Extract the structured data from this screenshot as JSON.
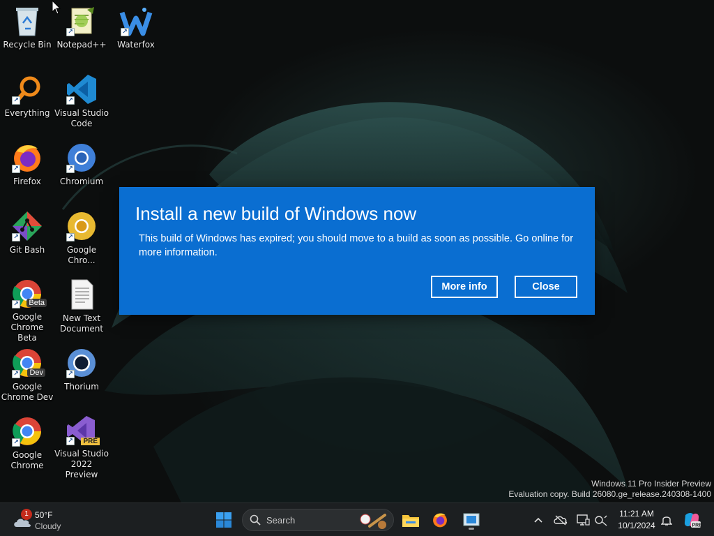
{
  "desktop_icons": [
    {
      "label": "Recycle Bin",
      "icon": "recycle-bin-icon",
      "shortcut": false
    },
    {
      "label": "Notepad++",
      "icon": "notepadpp-icon",
      "shortcut": true
    },
    {
      "label": "Waterfox",
      "icon": "waterfox-icon",
      "shortcut": true
    },
    {
      "label": "Everything",
      "icon": "everything-icon",
      "shortcut": true
    },
    {
      "label": "Visual Studio Code",
      "icon": "vscode-icon",
      "shortcut": true
    },
    {
      "label": "Firefox",
      "icon": "firefox-icon",
      "shortcut": true
    },
    {
      "label": "Chromium",
      "icon": "chromium-icon",
      "shortcut": true
    },
    {
      "label": "Git Bash",
      "icon": "git-bash-icon",
      "shortcut": true
    },
    {
      "label": "Google Chro...",
      "icon": "chrome-canary-icon",
      "shortcut": true
    },
    {
      "label": "Google Chrome Beta",
      "icon": "chrome-beta-icon",
      "shortcut": true,
      "badge": "Beta"
    },
    {
      "label": "New Text Document",
      "icon": "text-document-icon",
      "shortcut": false
    },
    {
      "label": "Google Chrome Dev",
      "icon": "chrome-dev-icon",
      "shortcut": true,
      "badge": "Dev"
    },
    {
      "label": "Thorium",
      "icon": "thorium-icon",
      "shortcut": true
    },
    {
      "label": "Google Chrome",
      "icon": "chrome-icon",
      "shortcut": true
    },
    {
      "label": "Visual Studio 2022 Preview",
      "icon": "visual-studio-icon",
      "shortcut": true,
      "badge": "PRE"
    }
  ],
  "dialog": {
    "title": "Install a new build of Windows now",
    "message": "This build of Windows has expired; you should move to a build as soon as possible. Go online for more information.",
    "more_info_label": "More info",
    "close_label": "Close",
    "background_color": "#0a6ed1"
  },
  "watermark": {
    "line1": "Windows 11 Pro Insider Preview",
    "line2": "Evaluation copy. Build 26080.ge_release.240308-1400"
  },
  "taskbar": {
    "weather": {
      "badge": "1",
      "temperature": "50°F",
      "condition": "Cloudy"
    },
    "search_placeholder": "Search",
    "pinned": [
      "start-icon",
      "search-icon",
      "file-explorer-icon",
      "firefox-icon",
      "virtual-machine-icon"
    ],
    "tray": [
      "chevron-up-icon",
      "onedrive-offline-icon",
      "display-icon",
      "network-volume-icon",
      "notification-bell-icon",
      "copilot-icon"
    ],
    "clock": {
      "time": "11:21 AM",
      "date": "10/1/2024"
    }
  }
}
